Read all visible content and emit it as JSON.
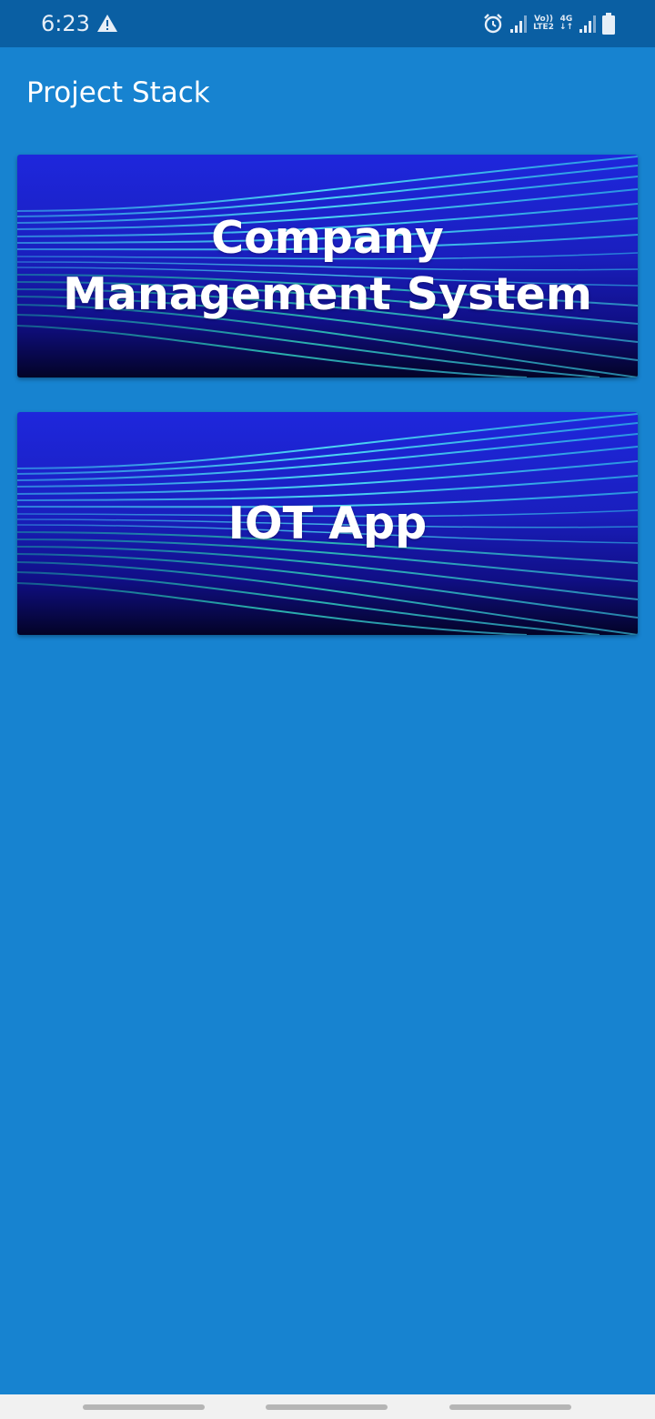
{
  "status_bar": {
    "time": "6:23",
    "volte_label_line1": "Vo))",
    "volte_label_line2": "LTE2",
    "network_label": "4G",
    "icons": [
      "warning-icon",
      "alarm-icon",
      "signal-icon",
      "volte-lte2-icon",
      "4g-data-icon",
      "signal-icon",
      "battery-icon"
    ]
  },
  "app_bar": {
    "title": "Project Stack"
  },
  "projects": [
    {
      "label": "Company Management System"
    },
    {
      "label": "IOT App"
    }
  ],
  "colors": {
    "background": "#1783d0",
    "status_bar": "#0a5fa3",
    "card_gradient_start": "#1a23d8",
    "card_gradient_end": "#040636",
    "card_lines": "#2fd1e8"
  }
}
